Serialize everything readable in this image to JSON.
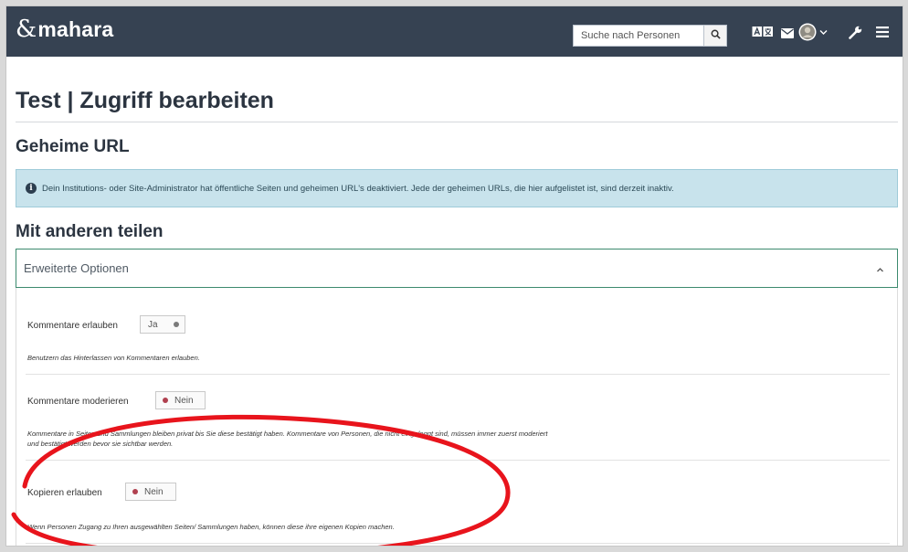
{
  "header": {
    "logo_text": "mahara",
    "logo_mark": "&",
    "search_placeholder": "Suche nach Personen",
    "icons": [
      "search-icon",
      "language-icon",
      "mail-icon",
      "avatar",
      "chevron-down-icon",
      "wrench-icon",
      "menu-icon"
    ]
  },
  "page": {
    "title": "Test | Zugriff bearbeiten",
    "secret_url_heading": "Geheime URL",
    "alert_text": "Dein Institutions- oder Site-Administrator hat öffentliche Seiten und geheimen URL's deaktiviert. Jede der geheimen URLs, die hier aufgelistet ist, sind derzeit inaktiv.",
    "share_heading": "Mit anderen teilen"
  },
  "advanced": {
    "toggle_label": "Erweiterte Optionen",
    "settings": [
      {
        "label": "Kommentare erlauben",
        "state": "Ja",
        "on": true,
        "description": "Benutzern das Hinterlassen von Kommentaren erlauben."
      },
      {
        "label": "Kommentare moderieren",
        "state": "Nein",
        "on": false,
        "description_line1": "Kommentare in Seiten und Sammlungen bleiben privat bis Sie diese bestätigt haben. Kommentare von Personen, die nicht eingeloggt sind, müssen immer zuerst moderiert",
        "description_line2": "und bestätigt werden bevor sie sichtbar werden."
      },
      {
        "label": "Kopieren erlauben",
        "state": "Nein",
        "on": false,
        "description": "Wenn Personen Zugang zu Ihren ausgewählten Seiten/ Sammlungen haben, können diese ihre eigenen Kopien machen."
      }
    ]
  },
  "colors": {
    "header_bg": "#364252",
    "alert_bg": "#c8e3ec",
    "panel_border": "#3c8a6e",
    "annotation": "#e8141c",
    "toggle_on_dot": "#7a7a7a",
    "toggle_off_dot": "#b0404f"
  }
}
